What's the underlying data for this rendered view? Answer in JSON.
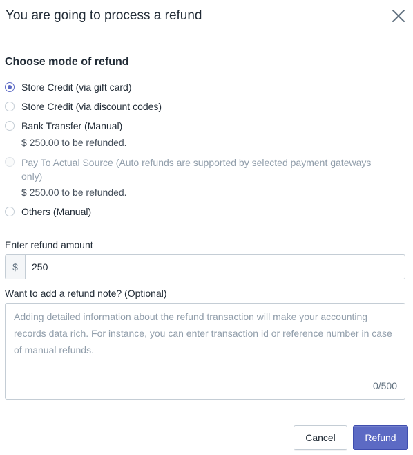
{
  "header": {
    "title": "You are going to process a refund",
    "close_icon": "close-icon"
  },
  "refund_mode": {
    "title": "Choose mode of refund",
    "options": [
      {
        "label": "Store Credit (via gift card)",
        "checked": true,
        "disabled": false
      },
      {
        "label": "Store Credit (via discount codes)",
        "checked": false,
        "disabled": false
      },
      {
        "label": "Bank Transfer (Manual)",
        "checked": false,
        "disabled": false,
        "note": "$ 250.00 to be refunded."
      },
      {
        "label": "Pay To Actual Source (Auto refunds are supported by selected payment gateways only)",
        "checked": false,
        "disabled": true,
        "note": "$ 250.00 to be refunded."
      },
      {
        "label": "Others (Manual)",
        "checked": false,
        "disabled": false
      }
    ]
  },
  "amount": {
    "label": "Enter refund amount",
    "prefix": "$",
    "value": "250"
  },
  "note": {
    "label": "Want to add a refund note? (Optional)",
    "placeholder": "Adding detailed information about the refund transaction will make your accounting records data rich. For instance, you can enter transaction id or reference number in case of manual refunds.",
    "counter": "0/500"
  },
  "footer": {
    "cancel_label": "Cancel",
    "refund_label": "Refund"
  },
  "colors": {
    "accent": "#5c6ac4",
    "border": "#c4cdd5",
    "text": "#212b36",
    "muted": "#919eab"
  }
}
